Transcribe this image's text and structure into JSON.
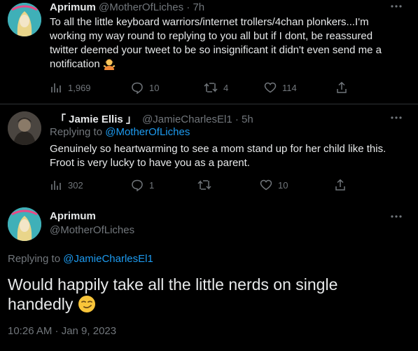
{
  "tweet1": {
    "name": "Aprimum",
    "handle": "@MotherOfLiches",
    "time": "· 7h",
    "text": "To all the little keyboard warriors/internet trollers/4chan plonkers...I'm working my way round to replying to you all but if I dont, be reassured twitter deemed your tweet to be so insignificant it didn't even send me a notification",
    "views": "1,969",
    "replies": "10",
    "retweets": "4",
    "likes": "114"
  },
  "tweet2": {
    "name": "「 Jamie Ellis 」",
    "handle": "@JamieCharlesEl1",
    "time": "· 5h",
    "replying_label": "Replying to",
    "replying_to": "@MotherOfLiches",
    "text": "Genuinely so heartwarming to see a mom stand up for her child like this. Froot is very lucky to have you as a parent.",
    "views": "302",
    "replies": "1",
    "retweets": "",
    "likes": "10"
  },
  "main": {
    "name": "Aprimum",
    "handle": "@MotherOfLiches",
    "replying_label": "Replying to",
    "replying_to": "@JamieCharlesEl1",
    "text": "Would happily take all the little nerds on single handedly",
    "timestamp": "10:26 AM · Jan 9, 2023"
  },
  "icons": {
    "more": "more-icon",
    "views": "views-icon",
    "reply": "reply-icon",
    "retweet": "retweet-icon",
    "like": "like-icon",
    "share": "share-icon"
  },
  "colors": {
    "background": "#000000",
    "text": "#e7e9ea",
    "muted": "#71767b",
    "link": "#1d9bf0"
  }
}
